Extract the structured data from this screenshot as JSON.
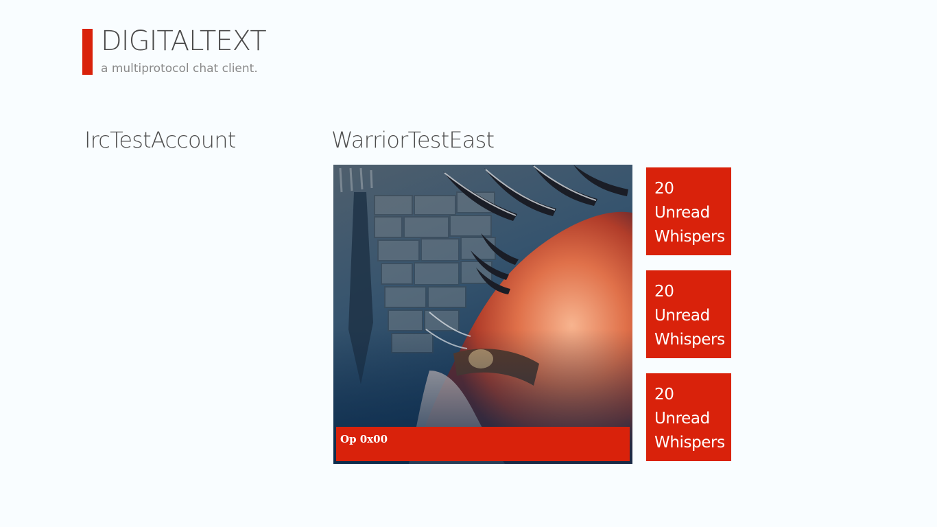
{
  "app": {
    "title": "DIGITALTEXT",
    "subtitle": "a multiprotocol chat client.",
    "accent_color": "#d9220b",
    "background_color": "#f9fdff"
  },
  "accounts": [
    {
      "name": "IrcTestAccount"
    },
    {
      "name": "WarriorTestEast",
      "channel_tile": {
        "caption": "Op 0x00",
        "image_icon": "diablo-art-image"
      },
      "whisper_tiles": [
        {
          "count": "20",
          "line1": "Unread",
          "line2": "Whispers"
        },
        {
          "count": "20",
          "line1": "Unread",
          "line2": "Whispers"
        },
        {
          "count": "20",
          "line1": "Unread",
          "line2": "Whispers"
        }
      ]
    }
  ]
}
